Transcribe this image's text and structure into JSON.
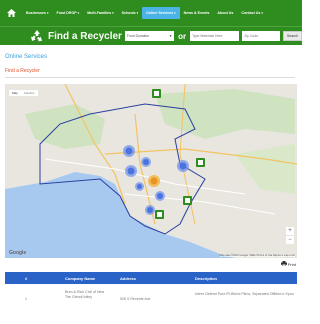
{
  "nav": {
    "items": [
      {
        "label": "Businesses",
        "active": false
      },
      {
        "label": "Food DROP",
        "active": false
      },
      {
        "label": "Multi-Families",
        "active": false
      },
      {
        "label": "Schools",
        "active": false
      },
      {
        "label": "Online Services",
        "active": true
      },
      {
        "label": "News & Events",
        "active": false
      },
      {
        "label": "About Us",
        "active": false
      },
      {
        "label": "Contact Us",
        "active": false
      }
    ],
    "caret": "▾"
  },
  "finder": {
    "title": "Find a Recycler",
    "select_value": "Food Donation",
    "or_text": "or",
    "name_placeholder": "Type Materials Here",
    "zip_placeholder": "Zip Code",
    "search_label": "Search"
  },
  "page": {
    "section_title": "Online Services",
    "sub_link": "Find a Recycler"
  },
  "map": {
    "view_map": "Map",
    "view_satellite": "Satellite",
    "zoom_in": "+",
    "zoom_out": "−",
    "google": "Google",
    "attribution": "Map data ©2016 Google, INEGI   Terms of Use   Report a map error"
  },
  "table": {
    "print_label": "Print",
    "headers": [
      "#",
      "Company Name",
      "Address",
      "Description"
    ],
    "rows": [
      {
        "num": "1",
        "company": "Bren & Rich Civil of New Tire Glendl Intley",
        "address": "526 S Revelde Ave",
        "description": "Intern Defend Pure IR-Blend Pilms, Separated Offlibre-b Spun"
      }
    ]
  },
  "colors": {
    "green": "#2f8c1f",
    "active_tab": "#4bb3e6",
    "table_header": "#2a63c8",
    "title_blue": "#3aa0d8",
    "link_orange": "#e05028"
  }
}
